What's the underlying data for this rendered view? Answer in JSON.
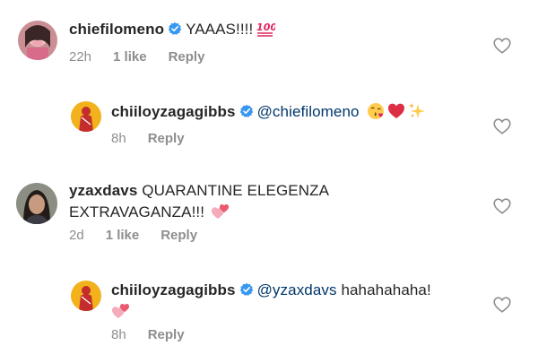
{
  "comments": [
    {
      "username": "chiefilomeno",
      "text": "YAAAS!!!!",
      "time": "22h",
      "likes": "1 like",
      "reply": "Reply",
      "emojis": [
        "hundred-points-emoji"
      ]
    },
    {
      "username": "chiiloyzagagibbs",
      "mention": "@chiefilomeno",
      "time": "8h",
      "reply": "Reply",
      "emojis": [
        "face-blowing-kiss-emoji",
        "red-heart-emoji",
        "sparkles-emoji"
      ]
    },
    {
      "username": "yzaxdavs",
      "text_line1": "QUARANTINE ELEGENZA",
      "text_line2": "EXTRAVAGANZA!!!",
      "time": "2d",
      "likes": "1 like",
      "reply": "Reply",
      "emojis": [
        "two-hearts-emoji"
      ]
    },
    {
      "username": "chiiloyzagagibbs",
      "mention": "@yzaxdavs",
      "text": "hahahahaha!",
      "time": "8h",
      "reply": "Reply",
      "emojis": [
        "two-hearts-emoji"
      ]
    }
  ],
  "colors": {
    "text": "#262626",
    "meta": "#8e8e8e",
    "mention": "#00376b",
    "verified": "#3897f0",
    "heart_outline": "#8e8e8e"
  }
}
